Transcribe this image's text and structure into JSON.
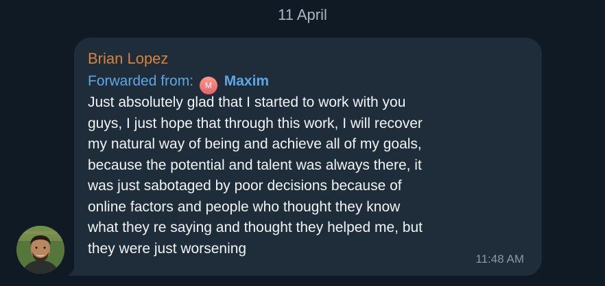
{
  "date_separator": "11 April",
  "message": {
    "sender": "Brian Lopez",
    "forwarded_label": "Forwarded from:",
    "forwarded_avatar_initial": "M",
    "forwarded_name": "Maxim",
    "text": "Just absolutely glad that I started to work with you\nguys, I just hope that through this work, I will recover\nmy natural way of being and achieve all of my goals,\nbecause the potential and talent was always there, it\nwas just sabotaged by poor decisions because of\nonline factors and people who thought they know\nwhat they re saying and thought they helped me, but\nthey were just worsening",
    "time": "11:48 AM"
  },
  "colors": {
    "background": "#101a24",
    "bubble": "#1f2c3a",
    "sender_name": "#d8843a",
    "forwarded": "#5ea7e2",
    "message_text": "#f1f4f7",
    "timestamp": "#8a97a6"
  },
  "icons": {
    "sender_avatar": "user-avatar-photo",
    "forwarded_avatar": "initial-avatar"
  }
}
